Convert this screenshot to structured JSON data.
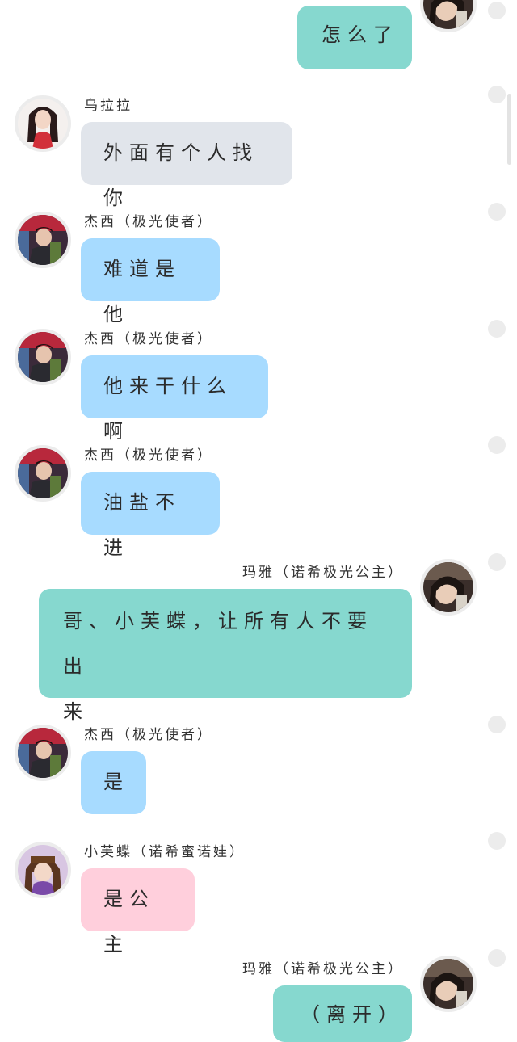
{
  "colors": {
    "self_bubble": "#86d8cf",
    "gray_bubble": "#e1e5eb",
    "blue_bubble": "#a7dbff",
    "pink_bubble": "#ffcfdc",
    "status_dot": "#ececec"
  },
  "messages": [
    {
      "side": "right",
      "sender": "",
      "text": "怎么了",
      "bubble_color": "self_bubble",
      "avatar": "mary-avatar"
    },
    {
      "side": "left",
      "sender": "乌拉拉",
      "text": "外面有个人找你",
      "bubble_color": "gray_bubble",
      "avatar": "wulala-avatar"
    },
    {
      "side": "left",
      "sender": "杰西（极光使者）",
      "text": "难道是他",
      "bubble_color": "blue_bubble",
      "avatar": "jesse-avatar"
    },
    {
      "side": "left",
      "sender": "杰西（极光使者）",
      "text": "他来干什么啊",
      "bubble_color": "blue_bubble",
      "avatar": "jesse-avatar"
    },
    {
      "side": "left",
      "sender": "杰西（极光使者）",
      "text": "油盐不进",
      "bubble_color": "blue_bubble",
      "avatar": "jesse-avatar"
    },
    {
      "side": "right",
      "sender": "玛雅（诺希极光公主）",
      "text_lines": [
        "哥、小芙蝶，让所有人不要出",
        "来"
      ],
      "bubble_color": "self_bubble",
      "avatar": "mary-avatar"
    },
    {
      "side": "left",
      "sender": "杰西（极光使者）",
      "text": "是",
      "bubble_color": "blue_bubble",
      "avatar": "jesse-avatar"
    },
    {
      "side": "left",
      "sender": "小芙蝶（诺希蜜诺娃）",
      "text": "是公主",
      "bubble_color": "pink_bubble",
      "avatar": "xiaofudie-avatar"
    },
    {
      "side": "right",
      "sender": "玛雅（诺希极光公主）",
      "text": "（离开）",
      "bubble_color": "self_bubble",
      "avatar": "mary-avatar"
    }
  ]
}
